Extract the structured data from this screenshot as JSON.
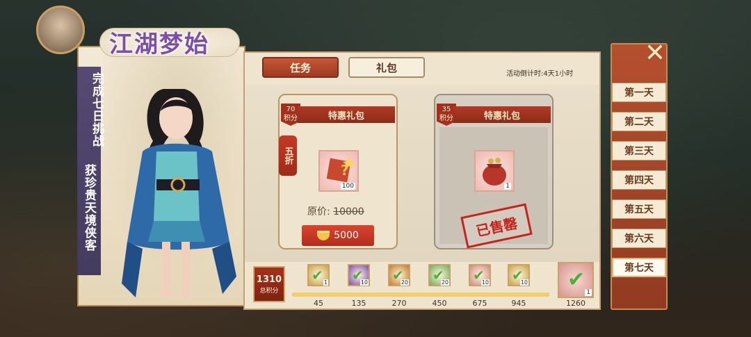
{
  "event": {
    "title": "江湖梦始",
    "vertical_left": "完成七日挑战",
    "vertical_right": "获珍贵天境侠客"
  },
  "tabs": [
    {
      "label": "任务",
      "active": true
    },
    {
      "label": "礼包",
      "active": false
    }
  ],
  "countdown": "活动倒计时:4天1小时",
  "cards": [
    {
      "name": "特惠礼包",
      "points_value": "70",
      "points_label": "积分",
      "discount": "五折",
      "item_count": "100",
      "original_price_label": "原价:",
      "original_price": "10000",
      "price": "5000",
      "sold": false
    },
    {
      "name": "特惠礼包",
      "points_value": "35",
      "points_label": "积分",
      "item_count": "1",
      "sold": true,
      "sold_label": "已售罄"
    }
  ],
  "progress": {
    "total_value": "1310",
    "total_label": "总积分",
    "fill_fraction": 1.0,
    "milestones": [
      {
        "value": "45",
        "count": "1",
        "color": "#c9a24b",
        "claimed": true
      },
      {
        "value": "135",
        "count": "10",
        "color": "#7a4fb0",
        "claimed": true
      },
      {
        "value": "270",
        "count": "20",
        "color": "#c47a2e",
        "claimed": true
      },
      {
        "value": "450",
        "count": "20",
        "color": "#6fae5a",
        "claimed": true
      },
      {
        "value": "675",
        "count": "10",
        "color": "#d08a86",
        "claimed": true
      },
      {
        "value": "945",
        "count": "10",
        "color": "#c9a24b",
        "claimed": true
      }
    ],
    "final": {
      "value": "1260",
      "count": "1",
      "claimed": true
    }
  },
  "days": [
    {
      "label": "第一天",
      "active": false
    },
    {
      "label": "第二天",
      "active": false
    },
    {
      "label": "第三天",
      "active": false
    },
    {
      "label": "第四天",
      "active": false
    },
    {
      "label": "第五天",
      "active": false
    },
    {
      "label": "第六天",
      "active": false
    },
    {
      "label": "第七天",
      "active": true
    }
  ],
  "icons": {
    "close": "close-icon",
    "check": "check-icon",
    "currency": "gold-ingot-icon"
  }
}
